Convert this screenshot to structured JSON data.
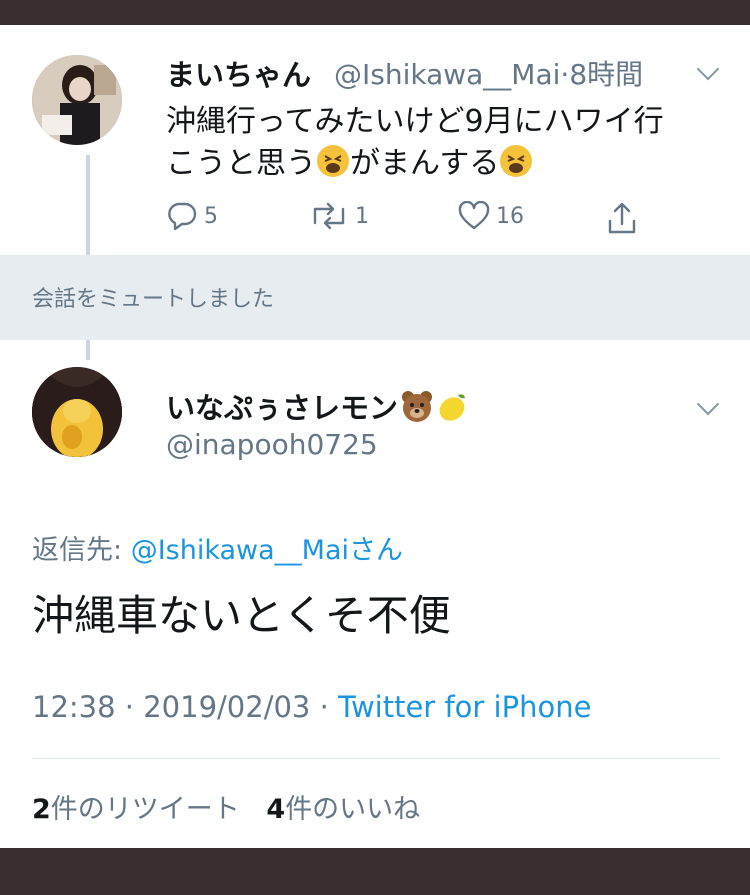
{
  "colors": {
    "accent": "#1b95e0",
    "muted_bg": "#e6ecf0",
    "secondary_text": "#657786",
    "frame": "#3a2f30"
  },
  "tweet1": {
    "name": "まいちゃん",
    "handle": "@Ishikawa__Mai",
    "separator": "·",
    "time": "8時間",
    "text_line1": "沖縄行ってみたいけど9月にハワイ行",
    "text_line2a": "こうと思う",
    "text_line2b": "がまんする",
    "emoji": "tired-face",
    "actions": {
      "reply_count": "5",
      "retweet_count": "1",
      "like_count": "16"
    }
  },
  "muted_banner": {
    "text": "会話をミュートしました"
  },
  "tweet2": {
    "name": "いなぷぅさレモン",
    "name_emojis": [
      "bear-face",
      "lemon"
    ],
    "handle": "@inapooh0725",
    "reply_to_label": "返信先: ",
    "reply_to_handle": "@Ishikawa__Maiさん",
    "text": "沖縄車ないとくそ不便",
    "timestamp": "12:38 · 2019/02/03 · ",
    "via": "Twitter for iPhone",
    "retweets_count": "2",
    "retweets_label": "件のリツイート",
    "likes_count": "4",
    "likes_label": "件のいいね"
  }
}
